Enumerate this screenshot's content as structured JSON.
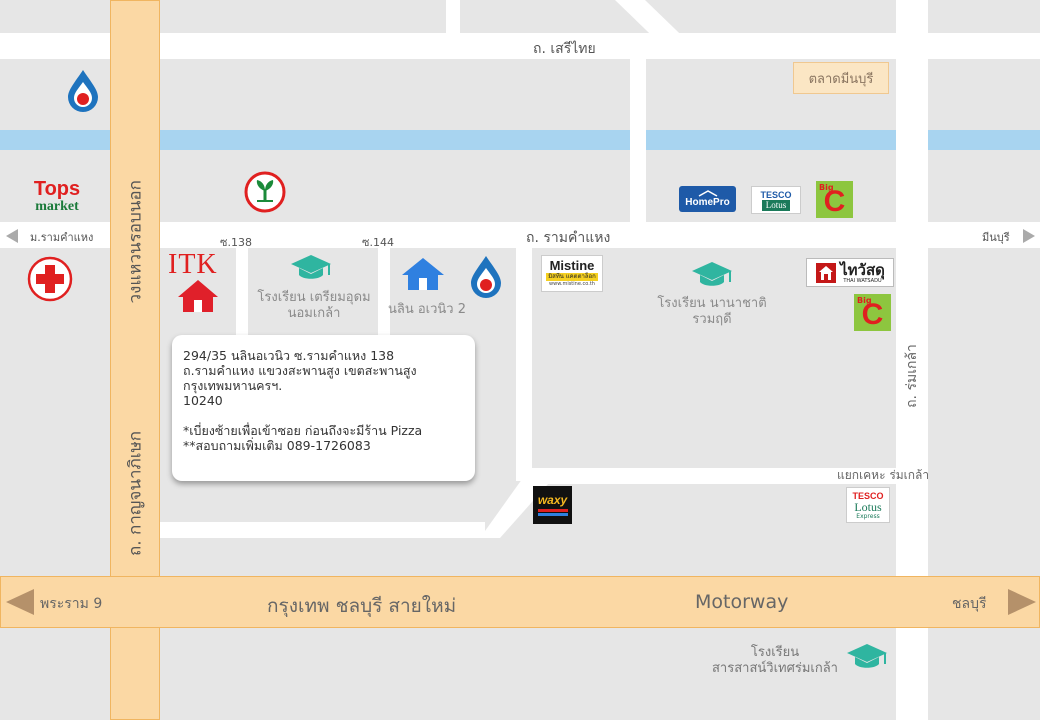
{
  "map": {
    "roads": {
      "seri_thai": "ถ. เสรีไทย",
      "ramkhamhaeng": "ถ. รามคำแหง",
      "ramkhamhaeng_short": "ม.รามคำแหง",
      "minburi_dir": "มีนบุรี",
      "soi_138": "ซ.138",
      "soi_144": "ซ.144",
      "ring_road_top": "วงแหวนรอบนอก",
      "ring_road_bottom": "ถ. กาญจนาภิเษก",
      "rom_klao": "ถ. ร่มเกล้า",
      "motorway_thai": "กรุงเทพ ชลบุรี สายใหม่",
      "motorway_en": "Motorway",
      "rama9_dir": "พระราม 9",
      "chonburi_dir": "ชลบุรี"
    },
    "places": {
      "market": "ตลาดมีนบุรี",
      "tops_line1": "Tops",
      "tops_line2": "market",
      "itk": "ITK",
      "school_triam_line1": "โรงเรียน เตรียมอุดม",
      "school_triam_line2": "นอมเกล้า",
      "nalin": "นลิน อเวนิว 2",
      "school_nana_line1": "โรงเรียน นานาชาติ",
      "school_nana_line2": "รวมฤดี",
      "junction": "แยกเคหะ ร่มเกล้า",
      "school_sarasas_line1": "โรงเรียน",
      "school_sarasas_line2": "สารสาสน์วิเทศร่มเกล้า"
    },
    "logos": {
      "homepro": "HomePro",
      "tesco_top": "TESCO",
      "tesco_bottom": "Lotus",
      "mistine": "Mistine",
      "mistine_sub": "มิสทีน แคตตาล็อก",
      "mistine_url": "www.mistine.co.th",
      "thai_watsadu": "ไทวัสดุ",
      "thai_watsadu_en": "THAI WATSADU",
      "waxy": "waxy",
      "tesco_express_top": "TESCO",
      "tesco_express_mid": "Lotus",
      "tesco_express_bottom": "Express",
      "bigc_small": "Big",
      "bigc_letter": "C"
    },
    "address": {
      "line1": "294/35 นลินอเวนิว ซ.รามคำแหง 138",
      "line2": "ถ.รามคำแหง แขวงสะพานสูง เขตสะพานสูง",
      "line3": "กรุงเทพมหานครฯ.",
      "line4": "10240",
      "note1": "*เบี่ยงซ้ายเพื่อเข้าซอย ก่อนถึงจะมีร้าน Pizza",
      "note2": "**สอบถามเพิ่มเติม 089-1726083"
    },
    "colors": {
      "ptt_blue": "#1e73be",
      "ptt_red": "#e02020",
      "home_red": "#e0202a",
      "home_blue": "#2f80e0",
      "school_teal": "#2fb5a0",
      "bigc_green": "#8dc63f",
      "bigc_red": "#e02020",
      "motorway": "#fbd8a4"
    },
    "icons": [
      "ptt-gas-icon",
      "kbank-icon",
      "hospital-cross-icon",
      "home-icon",
      "graduation-cap-icon",
      "arrow-left-icon",
      "arrow-right-icon"
    ]
  }
}
